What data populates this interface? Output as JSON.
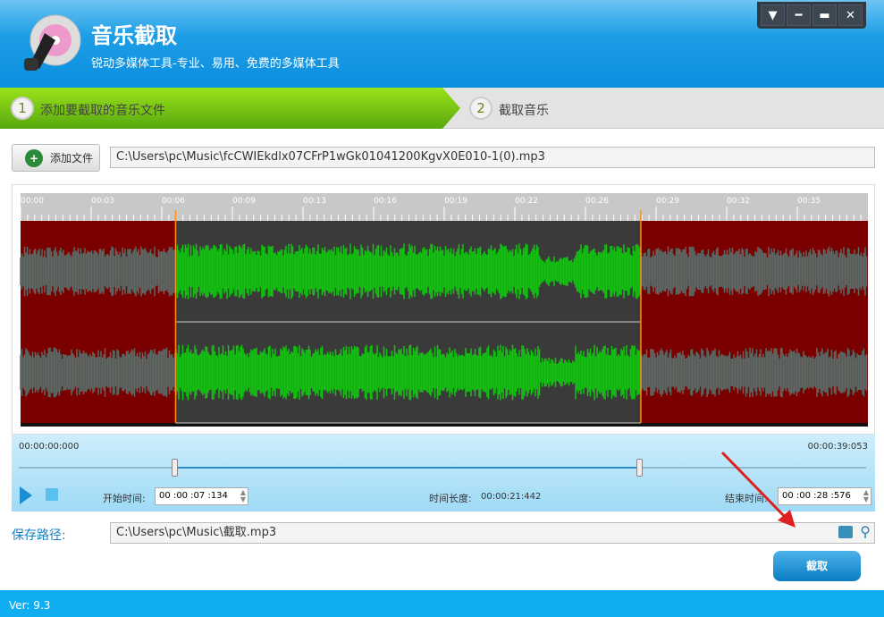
{
  "header": {
    "title": "音乐截取",
    "subtitle": "锐动多媒体工具-专业、易用、免费的多媒体工具"
  },
  "window_buttons": [
    "menu",
    "minimize",
    "maximize",
    "close"
  ],
  "steps": [
    {
      "num": "1",
      "label": "添加要截取的音乐文件"
    },
    {
      "num": "2",
      "label": "截取音乐"
    }
  ],
  "add_file": {
    "label": "添加文件",
    "path": "C:\\Users\\pc\\Music\\fcCWIEkdlx07CFrP1wGk01041200KgvX0E010-1(0).mp3"
  },
  "ruler": [
    "00:00",
    "00:03",
    "00:06",
    "00:09",
    "00:13",
    "00:16",
    "00:19",
    "00:22",
    "00:26",
    "00:29",
    "00:32",
    "00:35"
  ],
  "selection": {
    "start_fraction": 0.183,
    "end_fraction": 0.732
  },
  "colors": {
    "selected": "#11c40f",
    "unselected": "#7a0000",
    "wave_gray": "#5a6a66"
  },
  "controls": {
    "total_start": "00:00:00:000",
    "total_end": "00:00:39:053",
    "start_label": "开始时间:",
    "start_value": "00 :00 :07 :134",
    "length_label": "时间长度:",
    "length_value": "00:00:21:442",
    "end_label": "结束时间:",
    "end_value": "00 :00 :28 :576"
  },
  "save": {
    "label": "保存路径:",
    "path": "C:\\Users\\pc\\Music\\截取.mp3"
  },
  "cut_button": "截取",
  "footer": {
    "version": "Ver: 9.3"
  }
}
